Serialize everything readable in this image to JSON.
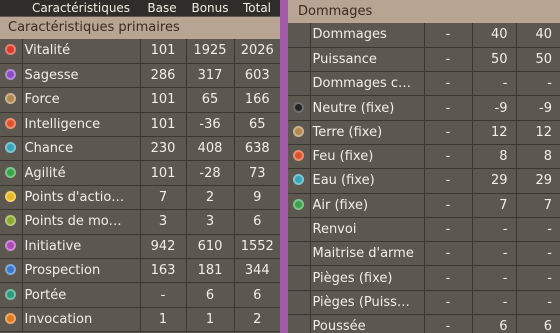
{
  "left": {
    "headers": {
      "name": "Caractéristiques",
      "base": "Base",
      "bonus": "Bonus",
      "total": "Total"
    },
    "section_title": "Caractéristiques primaires",
    "rows": [
      {
        "icon": "heart-icon",
        "icon_color": "#d93a2b",
        "name": "Vitalité",
        "base": "101",
        "bonus": "1925",
        "total": "2026"
      },
      {
        "icon": "wisdom-icon",
        "icon_color": "#8a4fc4",
        "name": "Sagesse",
        "base": "286",
        "bonus": "317",
        "total": "603"
      },
      {
        "icon": "strength-icon",
        "icon_color": "#b08850",
        "name": "Force",
        "base": "101",
        "bonus": "65",
        "total": "166"
      },
      {
        "icon": "fire-icon",
        "icon_color": "#e0532a",
        "name": "Intelligence",
        "base": "101",
        "bonus": "-36",
        "total": "65"
      },
      {
        "icon": "water-icon",
        "icon_color": "#3aa5b8",
        "name": "Chance",
        "base": "230",
        "bonus": "408",
        "total": "638"
      },
      {
        "icon": "air-icon",
        "icon_color": "#3aa24a",
        "name": "Agilité",
        "base": "101",
        "bonus": "-28",
        "total": "73"
      },
      {
        "icon": "star-icon",
        "icon_color": "#e8b820",
        "name": "Points d'actio…",
        "base": "7",
        "bonus": "2",
        "total": "9"
      },
      {
        "icon": "boot-icon",
        "icon_color": "#8da830",
        "name": "Points de mo…",
        "base": "3",
        "bonus": "3",
        "total": "6"
      },
      {
        "icon": "initiative-icon",
        "icon_color": "#b04ab8",
        "name": "Initiative",
        "base": "942",
        "bonus": "610",
        "total": "1552"
      },
      {
        "icon": "prospection-icon",
        "icon_color": "#3a78c8",
        "name": "Prospection",
        "base": "163",
        "bonus": "181",
        "total": "344"
      },
      {
        "icon": "range-icon",
        "icon_color": "#2f9a7a",
        "name": "Portée",
        "base": "-",
        "bonus": "6",
        "total": "6"
      },
      {
        "icon": "summon-icon",
        "icon_color": "#e07a20",
        "name": "Invocation",
        "base": "1",
        "bonus": "1",
        "total": "2"
      }
    ]
  },
  "right": {
    "section_title": "Dommages",
    "rows": [
      {
        "icon": "",
        "name": "Dommages",
        "base": "-",
        "bonus": "40",
        "total": "40"
      },
      {
        "icon": "",
        "name": "Puissance",
        "base": "-",
        "bonus": "50",
        "total": "50"
      },
      {
        "icon": "",
        "name": "Dommages c…",
        "base": "-",
        "bonus": "-",
        "total": "-"
      },
      {
        "icon": "neutral-icon",
        "icon_color": "#222222",
        "name": "Neutre (fixe)",
        "base": "-",
        "bonus": "-9",
        "total": "-9"
      },
      {
        "icon": "earth-icon",
        "icon_color": "#b08850",
        "name": "Terre (fixe)",
        "base": "-",
        "bonus": "12",
        "total": "12"
      },
      {
        "icon": "fire-icon",
        "icon_color": "#e0532a",
        "name": "Feu (fixe)",
        "base": "-",
        "bonus": "8",
        "total": "8"
      },
      {
        "icon": "water-icon",
        "icon_color": "#3aa5b8",
        "name": "Eau (fixe)",
        "base": "-",
        "bonus": "29",
        "total": "29"
      },
      {
        "icon": "air-icon",
        "icon_color": "#3aa24a",
        "name": "Air (fixe)",
        "base": "-",
        "bonus": "7",
        "total": "7"
      },
      {
        "icon": "",
        "name": "Renvoi",
        "base": "-",
        "bonus": "-",
        "total": "-"
      },
      {
        "icon": "",
        "name": "Maitrise d'arme",
        "base": "-",
        "bonus": "-",
        "total": "-"
      },
      {
        "icon": "",
        "name": "Pièges (fixe)",
        "base": "-",
        "bonus": "-",
        "total": "-"
      },
      {
        "icon": "",
        "name": "Pièges (Puiss…",
        "base": "-",
        "bonus": "-",
        "total": "-"
      },
      {
        "icon": "",
        "name": "Poussée",
        "base": "-",
        "bonus": "6",
        "total": "6"
      }
    ]
  },
  "colors": {
    "background": "#5c5850",
    "section_bar": "#b8a493",
    "divider": "#a25ba6",
    "header_bar": "#2f2d29"
  }
}
